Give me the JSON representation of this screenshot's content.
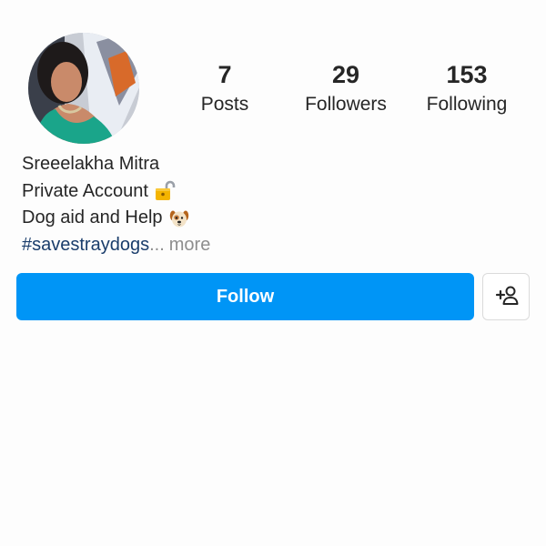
{
  "profile": {
    "stats": {
      "posts": {
        "value": "7",
        "label": "Posts"
      },
      "followers": {
        "value": "29",
        "label": "Followers"
      },
      "following": {
        "value": "153",
        "label": "Following"
      }
    },
    "bio": {
      "name": "Sreeelakha Mitra",
      "line2": "Private Account",
      "line3": "Dog aid and Help",
      "hashtag": "#savestraydogs",
      "ellipsis": "...",
      "more": "more"
    }
  },
  "actions": {
    "follow_label": "Follow",
    "suggest_icon": "add-person-icon"
  },
  "icons": {
    "line2_emoji": "lock-emoji",
    "line3_emoji": "dog-face-emoji"
  },
  "colors": {
    "follow_button": "#0095f6",
    "hashtag": "#1a3d6b",
    "muted": "#8e8e8e",
    "text": "#262626"
  }
}
